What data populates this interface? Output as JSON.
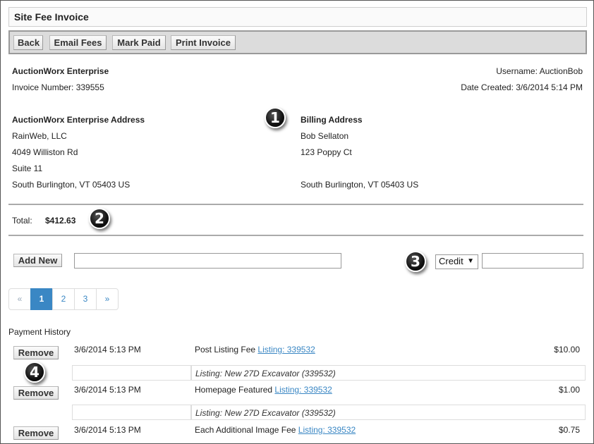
{
  "title": "Site Fee Invoice",
  "toolbar": {
    "back": "Back",
    "email": "Email Fees",
    "mark_paid": "Mark Paid",
    "print": "Print Invoice"
  },
  "company": {
    "name": "AuctionWorx Enterprise",
    "invoice_number": "Invoice Number: 339555"
  },
  "user": {
    "username": "Username: AuctionBob",
    "date_created": "Date Created: 3/6/2014 5:14 PM"
  },
  "company_address": {
    "heading": "AuctionWorx Enterprise Address",
    "line1": "RainWeb, LLC",
    "line2": "4049 Williston Rd",
    "line3": "Suite 11",
    "line4": "South Burlington, VT 05403 US"
  },
  "billing_address": {
    "heading": "Billing Address",
    "line1": "Bob Sellaton",
    "line2": "123 Poppy Ct",
    "line4": "South Burlington, VT 05403 US"
  },
  "markers": [
    "1",
    "2",
    "3",
    "4"
  ],
  "total": {
    "label": "Total:",
    "value": "$412.63"
  },
  "add_new": {
    "button": "Add New",
    "type_selected": "Credit"
  },
  "pagination": {
    "prev": "«",
    "pages": [
      "1",
      "2",
      "3"
    ],
    "next": "»",
    "current": "1"
  },
  "payment_history": {
    "heading": "Payment History",
    "remove_label": "Remove",
    "rows": [
      {
        "date": "3/6/2014 5:13 PM",
        "description": "Post Listing Fee",
        "link": "Listing: 339532",
        "amount": "$10.00",
        "note": "Listing: New 27D Excavator (339532)"
      },
      {
        "date": "3/6/2014 5:13 PM",
        "description": "Homepage Featured",
        "link": "Listing: 339532",
        "amount": "$1.00",
        "note": "Listing: New 27D Excavator (339532)"
      },
      {
        "date": "3/6/2014 5:13 PM",
        "description": "Each Additional Image Fee",
        "link": "Listing: 339532",
        "amount": "$0.75"
      }
    ]
  }
}
